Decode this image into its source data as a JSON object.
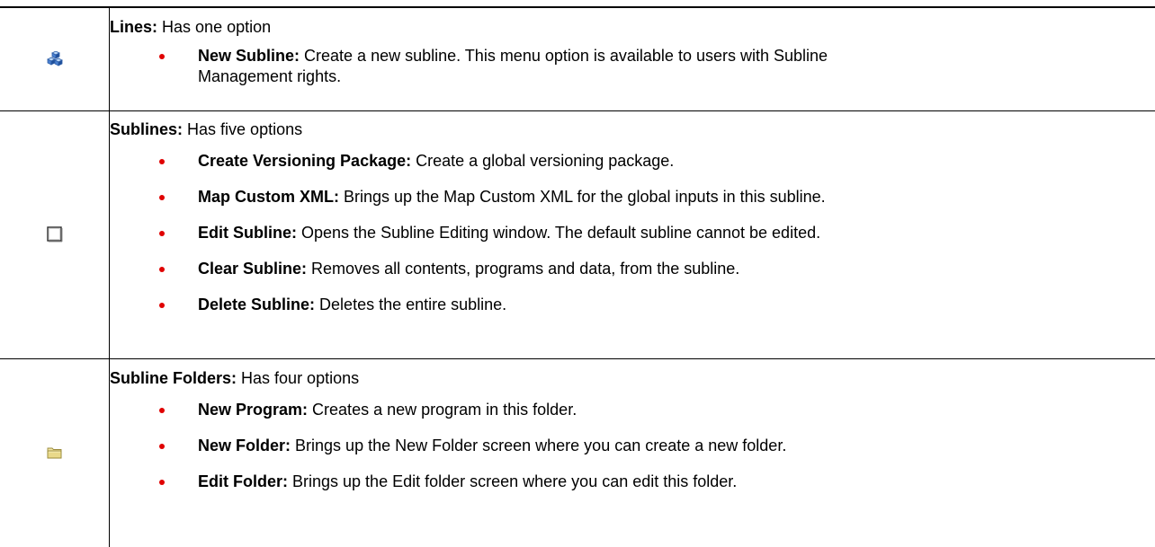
{
  "rows": [
    {
      "icon": "lines-icon",
      "heading": {
        "label": "Lines:",
        "text": "Has one option"
      },
      "options": [
        {
          "label": "New Subline:",
          "text": "Create a new subline. This menu option is available to users with Subline",
          "text_cont": "Management rights."
        }
      ]
    },
    {
      "icon": "subline-icon",
      "heading": {
        "label": "Sublines:",
        "text": "Has five options"
      },
      "options": [
        {
          "label": "Create Versioning Package:",
          "text": "Create a global versioning package."
        },
        {
          "label": "Map Custom XML:",
          "text": "Brings up the Map Custom XML for the global inputs in this subline."
        },
        {
          "label": "Edit Subline:",
          "text": "Opens the Subline Editing window. The default subline cannot be edited."
        },
        {
          "label": "Clear Subline:",
          "text": "Removes all contents, programs and data, from the subline."
        },
        {
          "label": "Delete Subline:",
          "text": "Deletes the entire subline."
        }
      ]
    },
    {
      "icon": "folder-icon",
      "heading": {
        "label": "Subline Folders:",
        "text": "Has four options"
      },
      "options": [
        {
          "label": "New Program:",
          "text": "Creates a new program in this folder."
        },
        {
          "label": "New Folder:",
          "text": "Brings up the New Folder screen where you can create a new folder."
        },
        {
          "label": "Edit Folder:",
          "text": "Brings up the Edit folder screen where you can edit this folder."
        }
      ]
    }
  ],
  "colors": {
    "bullet": "#e00000",
    "border": "#000000"
  }
}
